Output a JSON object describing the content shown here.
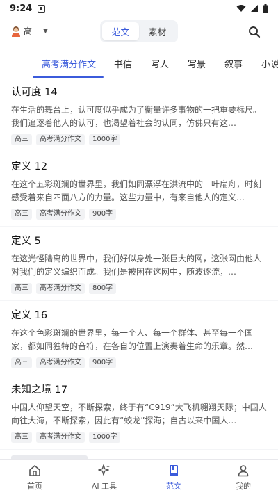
{
  "status_bar": {
    "time": "9:24"
  },
  "top_bar": {
    "grade": "高一",
    "segments": [
      {
        "label": "范文",
        "active": true
      },
      {
        "label": "素材",
        "active": false
      }
    ]
  },
  "tabs": [
    {
      "label": "高考满分作文",
      "active": true
    },
    {
      "label": "书信",
      "active": false
    },
    {
      "label": "写人",
      "active": false
    },
    {
      "label": "写景",
      "active": false
    },
    {
      "label": "叙事",
      "active": false
    },
    {
      "label": "小说",
      "active": false
    }
  ],
  "essays": [
    {
      "title": "认可度 14",
      "excerpt": "在生活的舞台上，认可度似乎成为了衡量许多事物的一把重要标尺。我们追逐着他人的认可，也渴望着社会的认同，仿佛只有这…",
      "tags": [
        "高三",
        "高考满分作文",
        "1000字"
      ]
    },
    {
      "title": "定义 12",
      "excerpt": "在这个五彩斑斓的世界里，我们如同漂浮在洪流中的一叶扁舟，时刻感受着来自四面八方的力量。这些力量中，有来自他人的定义…",
      "tags": [
        "高三",
        "高考满分作文",
        "900字"
      ]
    },
    {
      "title": "定义 5",
      "excerpt": "在这光怪陆离的世界中，我们好似身处一张巨大的网，这张网由他人对我们的定义编织而成。我们是被困在这网中，随波逐流，…",
      "tags": [
        "高三",
        "高考满分作文",
        "800字"
      ]
    },
    {
      "title": "定义 16",
      "excerpt": "在这个色彩斑斓的世界里，每一个人、每一个群体、甚至每一个国家，都如同独特的音符，在各自的位置上演奏着生命的乐章。然…",
      "tags": [
        "高三",
        "高考满分作文",
        "900字"
      ]
    },
    {
      "title": "未知之境 17",
      "excerpt": "中国人仰望天空，不断探索，终于有“C919”大飞机翱翔天际；中国人向往大海，不断探索，因此有“蛟龙”探海；自古以来中国人…",
      "tags": [
        "高三",
        "高考满分作文",
        "1000字"
      ]
    }
  ],
  "bottom_nav": [
    {
      "label": "首页",
      "icon": "home-icon",
      "active": false
    },
    {
      "label": "AI 工具",
      "icon": "sparkle-icon",
      "active": false
    },
    {
      "label": "范文",
      "icon": "book-icon",
      "active": true
    },
    {
      "label": "我的",
      "icon": "person-icon",
      "active": false
    }
  ],
  "colors": {
    "accent": "#3b5bdb"
  }
}
